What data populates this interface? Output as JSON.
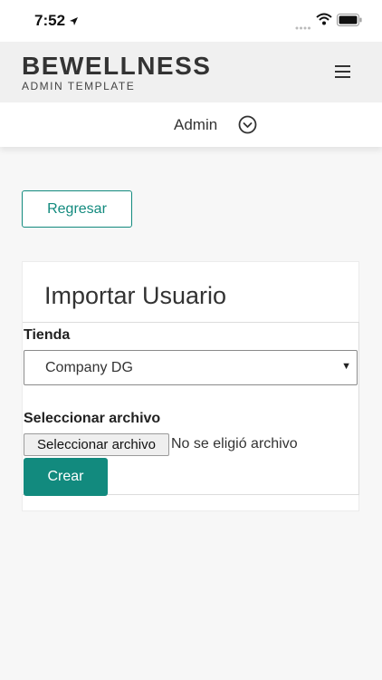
{
  "statusbar": {
    "time": "7:52",
    "icons": [
      "location-arrow-icon",
      "signal-dots-icon",
      "wifi-icon",
      "battery-icon"
    ]
  },
  "header": {
    "brand": "BEWELLNESS",
    "subtitle": "ADMIN TEMPLATE",
    "menu_icon": "hamburger-menu-icon"
  },
  "userbar": {
    "username": "Admin",
    "dropdown_icon": "chevron-down-circle-icon"
  },
  "actions": {
    "back_label": "Regresar"
  },
  "card": {
    "title": "Importar Usuario",
    "store_label": "Tienda",
    "store_selected": "Company DG",
    "file_label": "Seleccionar archivo",
    "file_button": "Seleccionar archivo",
    "file_status": "No se eligió archivo",
    "submit_label": "Crear"
  },
  "colors": {
    "accent": "#128a7e",
    "page_bg": "#f7f7f7",
    "header_bg": "#f0f0f0"
  }
}
